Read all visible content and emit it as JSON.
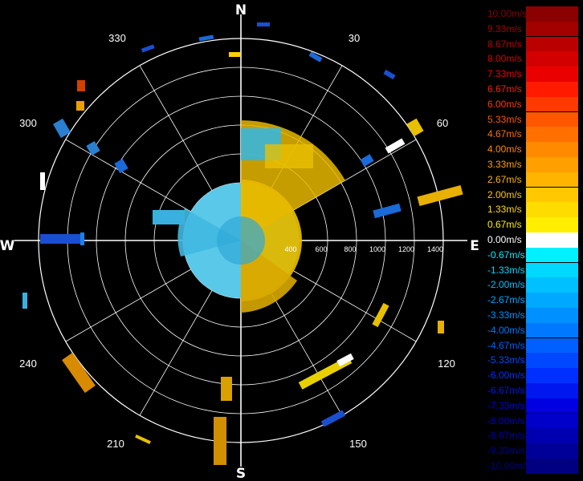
{
  "compass": {
    "north": "N",
    "east": "E",
    "south": "S",
    "west": "W"
  },
  "bearings": [
    "30",
    "60",
    "120",
    "150",
    "210",
    "240",
    "300",
    "330"
  ],
  "range_labels": [
    "400",
    "600",
    "800",
    "1000",
    "1200",
    "1400"
  ],
  "legend": {
    "items": [
      {
        "label": "10.00m/s",
        "color": "#8b0000"
      },
      {
        "label": "9.33m/s",
        "color": "#a30000"
      },
      {
        "label": "8.67m/s",
        "color": "#bb0000"
      },
      {
        "label": "8.00m/s",
        "color": "#d30000"
      },
      {
        "label": "7.33m/s",
        "color": "#eb0000"
      },
      {
        "label": "6.67m/s",
        "color": "#ff1a00"
      },
      {
        "label": "6.00m/s",
        "color": "#ff3a00"
      },
      {
        "label": "5.33m/s",
        "color": "#ff5600"
      },
      {
        "label": "4.67m/s",
        "color": "#ff7000"
      },
      {
        "label": "4.00m/s",
        "color": "#ff8a00"
      },
      {
        "label": "3.33m/s",
        "color": "#ffa000"
      },
      {
        "label": "2.67m/s",
        "color": "#ffb400"
      },
      {
        "label": "2.00m/s",
        "color": "#ffc800"
      },
      {
        "label": "1.33m/s",
        "color": "#ffdc00"
      },
      {
        "label": "0.67m/s",
        "color": "#ffee00"
      },
      {
        "label": "0.00m/s",
        "color": "#ffffff"
      },
      {
        "label": "-0.67m/s",
        "color": "#00f0ff"
      },
      {
        "label": "-1.33m/s",
        "color": "#00d8ff"
      },
      {
        "label": "-2.00m/s",
        "color": "#00c0ff"
      },
      {
        "label": "-2.67m/s",
        "color": "#00a8ff"
      },
      {
        "label": "-3.33m/s",
        "color": "#0090ff"
      },
      {
        "label": "-4.00m/s",
        "color": "#0078ff"
      },
      {
        "label": "-4.67m/s",
        "color": "#0060ff"
      },
      {
        "label": "-5.33m/s",
        "color": "#0048ff"
      },
      {
        "label": "-6.00m/s",
        "color": "#0030ff"
      },
      {
        "label": "-6.67m/s",
        "color": "#0018f0"
      },
      {
        "label": "-7.33m/s",
        "color": "#0000e0"
      },
      {
        "label": "-8.00m/s",
        "color": "#0000c8"
      },
      {
        "label": "-8.67m/s",
        "color": "#0000b0"
      },
      {
        "label": "-9.33m/s",
        "color": "#000098"
      },
      {
        "label": "-10.00m/s",
        "color": "#000080"
      }
    ]
  },
  "colors": {
    "background": "#000000",
    "grid": "#ffffff",
    "approaching": "#00ccff",
    "receding": "#e8c000"
  }
}
